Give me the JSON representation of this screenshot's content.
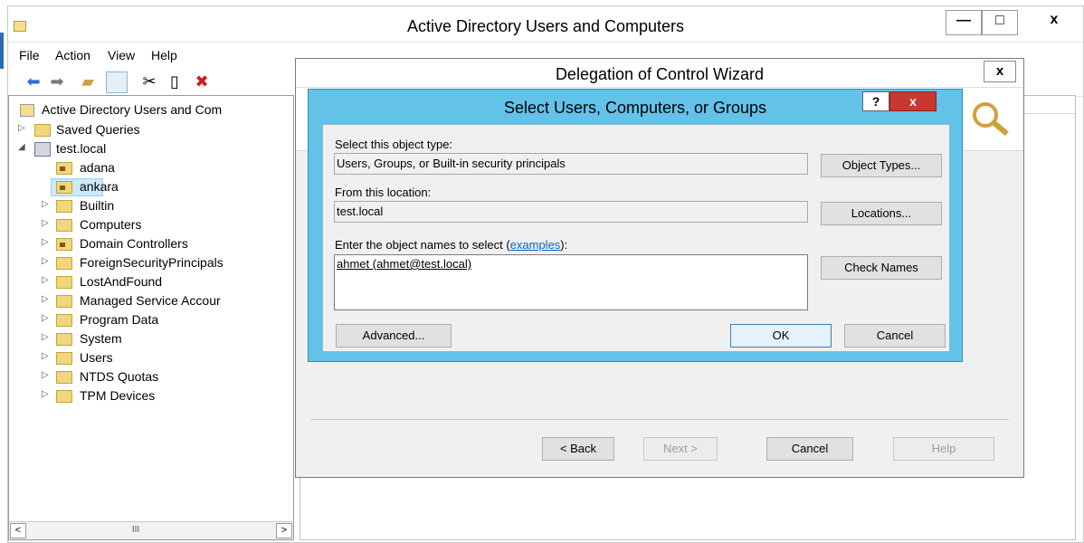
{
  "main_window": {
    "title": "Active Directory Users and Computers",
    "controls": {
      "minimize": "—",
      "maximize": "□",
      "close": "x"
    }
  },
  "menu": [
    "File",
    "Action",
    "View",
    "Help"
  ],
  "toolbar": {
    "back_icon": "back-arrow-icon",
    "forward_icon": "forward-arrow-icon",
    "up_folder_icon": "folder-up-icon",
    "console_tree_icon": "console-tree-icon",
    "cut_icon": "scissors-icon",
    "copy_icon": "clipboard-icon",
    "delete_icon": "red-x-icon",
    "accent_delete": "#cc1f1f"
  },
  "tree": {
    "root": "Active Directory Users and Com",
    "saved_queries": "Saved Queries",
    "domain": "test.local",
    "items": [
      {
        "label": "adana",
        "ou": true,
        "expandable": false
      },
      {
        "label": "ankara",
        "ou": true,
        "expandable": false,
        "selected": true
      },
      {
        "label": "Builtin",
        "ou": false,
        "expandable": true
      },
      {
        "label": "Computers",
        "ou": false,
        "expandable": true
      },
      {
        "label": "Domain Controllers",
        "ou": true,
        "expandable": true
      },
      {
        "label": "ForeignSecurityPrincipals",
        "ou": false,
        "expandable": true
      },
      {
        "label": "LostAndFound",
        "ou": false,
        "expandable": true
      },
      {
        "label": "Managed Service Accour",
        "ou": false,
        "expandable": true
      },
      {
        "label": "Program Data",
        "ou": false,
        "expandable": true
      },
      {
        "label": "System",
        "ou": false,
        "expandable": true
      },
      {
        "label": "Users",
        "ou": false,
        "expandable": true
      },
      {
        "label": "NTDS Quotas",
        "ou": false,
        "expandable": true
      },
      {
        "label": "TPM Devices",
        "ou": false,
        "expandable": true
      }
    ],
    "scroll": {
      "left": "<",
      "thumb": "III",
      "right": ">"
    }
  },
  "wizard": {
    "title": "Delegation of Control Wizard",
    "close": "x",
    "buttons": {
      "back": "< Back",
      "next": "Next >",
      "cancel": "Cancel",
      "help": "Help"
    }
  },
  "select_dialog": {
    "title": "Select Users, Computers, or Groups",
    "help": "?",
    "close": "x",
    "object_type_label": "Select this object type:",
    "object_type_value": "Users, Groups, or Built-in security principals",
    "object_types_button": "Object Types...",
    "location_label": "From this location:",
    "location_value": "test.local",
    "locations_button": "Locations...",
    "names_label_prefix": "Enter the object names to select (",
    "names_label_link": "examples",
    "names_label_suffix": "):",
    "names_value": "ahmet (ahmet@test.local)",
    "check_names_button": "Check Names",
    "advanced_button": "Advanced...",
    "ok_button": "OK",
    "cancel_button": "Cancel",
    "dialog_color": "#62c2e8",
    "close_color": "#c7382e"
  }
}
